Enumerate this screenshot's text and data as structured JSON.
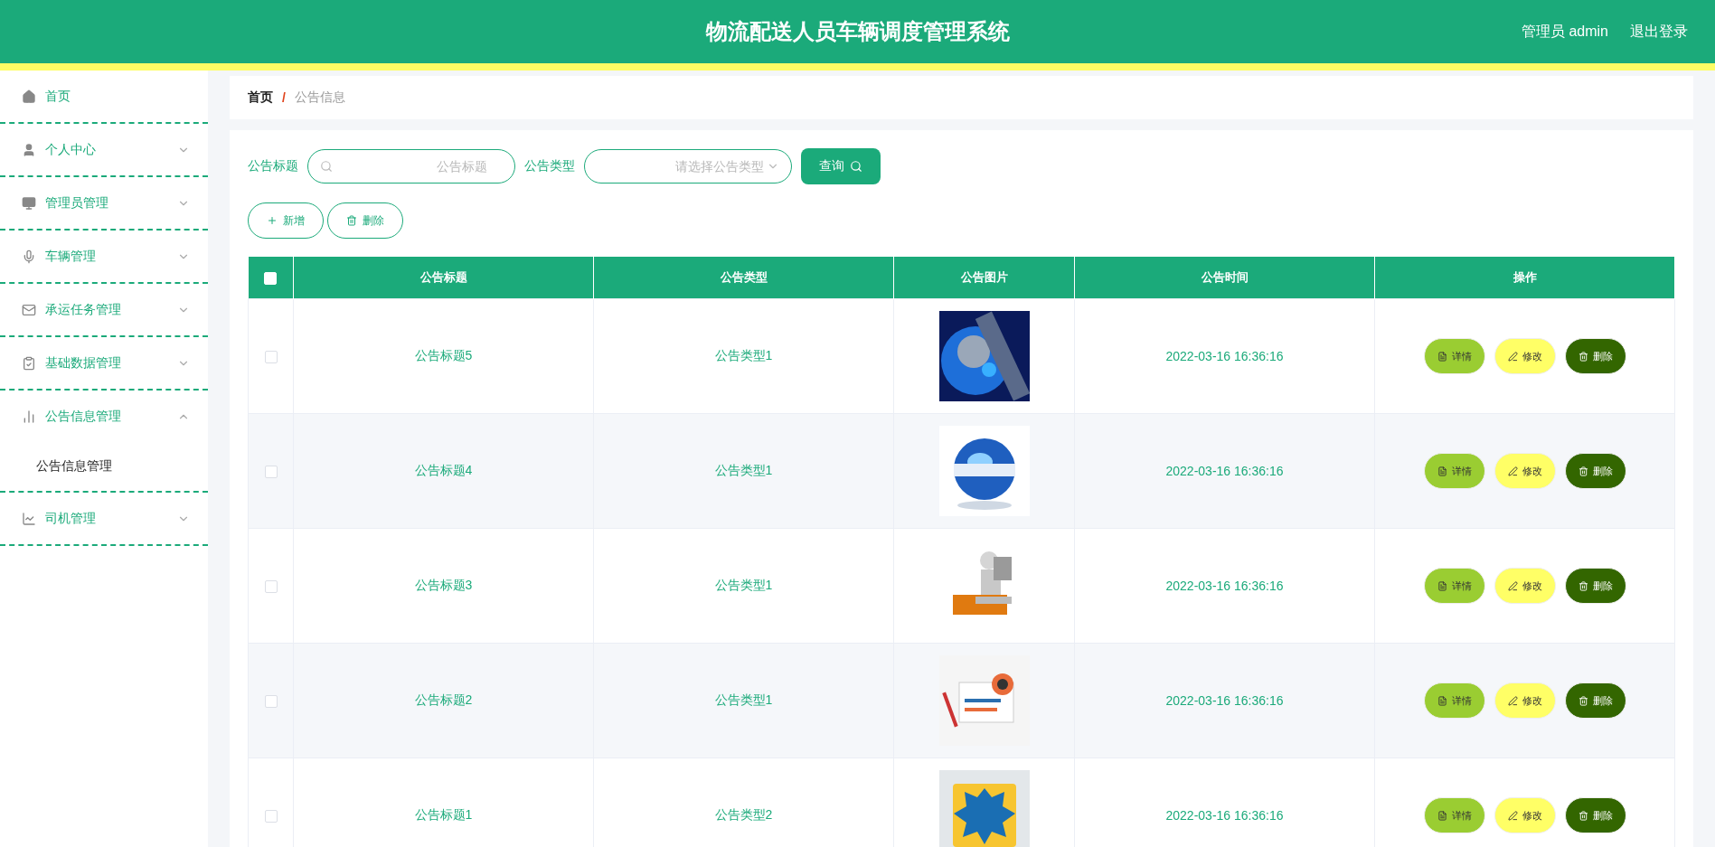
{
  "header": {
    "title": "物流配送人员车辆调度管理系统",
    "user": "管理员 admin",
    "logout": "退出登录"
  },
  "sidebar": {
    "items": [
      {
        "label": "首页"
      },
      {
        "label": "个人中心",
        "expanded": false
      },
      {
        "label": "管理员管理",
        "expanded": false
      },
      {
        "label": "车辆管理",
        "expanded": false
      },
      {
        "label": "承运任务管理",
        "expanded": false
      },
      {
        "label": "基础数据管理",
        "expanded": false
      },
      {
        "label": "公告信息管理",
        "expanded": true,
        "children": [
          {
            "label": "公告信息管理"
          }
        ]
      },
      {
        "label": "司机管理",
        "expanded": false
      }
    ]
  },
  "breadcrumb": {
    "home": "首页",
    "separator": "/",
    "current": "公告信息"
  },
  "search": {
    "title_label": "公告标题",
    "title_placeholder": "公告标题",
    "type_label": "公告类型",
    "type_placeholder": "请选择公告类型",
    "query_button": "查询"
  },
  "actions": {
    "add": "新增",
    "delete": "删除"
  },
  "table": {
    "header_checked": false,
    "columns": [
      "公告标题",
      "公告类型",
      "公告图片",
      "公告时间",
      "操作"
    ],
    "rows": [
      {
        "checked": false,
        "title": "公告标题5",
        "type": "公告类型1",
        "time": "2022-03-16 16:36:16",
        "buttons": [
          {
            "kind": "detail",
            "label": "详情"
          },
          {
            "kind": "edit",
            "label": "修改"
          },
          {
            "kind": "delete",
            "label": "删除"
          }
        ]
      },
      {
        "checked": false,
        "title": "公告标题4",
        "type": "公告类型1",
        "time": "2022-03-16 16:36:16",
        "buttons": [
          {
            "kind": "detail",
            "label": "详情"
          },
          {
            "kind": "edit",
            "label": "修改"
          },
          {
            "kind": "delete",
            "label": "删除"
          }
        ]
      },
      {
        "checked": false,
        "title": "公告标题3",
        "type": "公告类型1",
        "time": "2022-03-16 16:36:16",
        "buttons": [
          {
            "kind": "detail",
            "label": "详情"
          },
          {
            "kind": "edit",
            "label": "修改"
          },
          {
            "kind": "delete",
            "label": "删除"
          }
        ]
      },
      {
        "checked": false,
        "title": "公告标题2",
        "type": "公告类型1",
        "time": "2022-03-16 16:36:16",
        "buttons": [
          {
            "kind": "detail",
            "label": "详情"
          },
          {
            "kind": "edit",
            "label": "修改"
          },
          {
            "kind": "delete",
            "label": "删除"
          }
        ]
      },
      {
        "checked": false,
        "title": "公告标题1",
        "type": "公告类型2",
        "time": "2022-03-16 16:36:16",
        "buttons": [
          {
            "kind": "detail",
            "label": "详情"
          },
          {
            "kind": "edit",
            "label": "修改"
          },
          {
            "kind": "delete",
            "label": "删除"
          }
        ]
      }
    ]
  }
}
